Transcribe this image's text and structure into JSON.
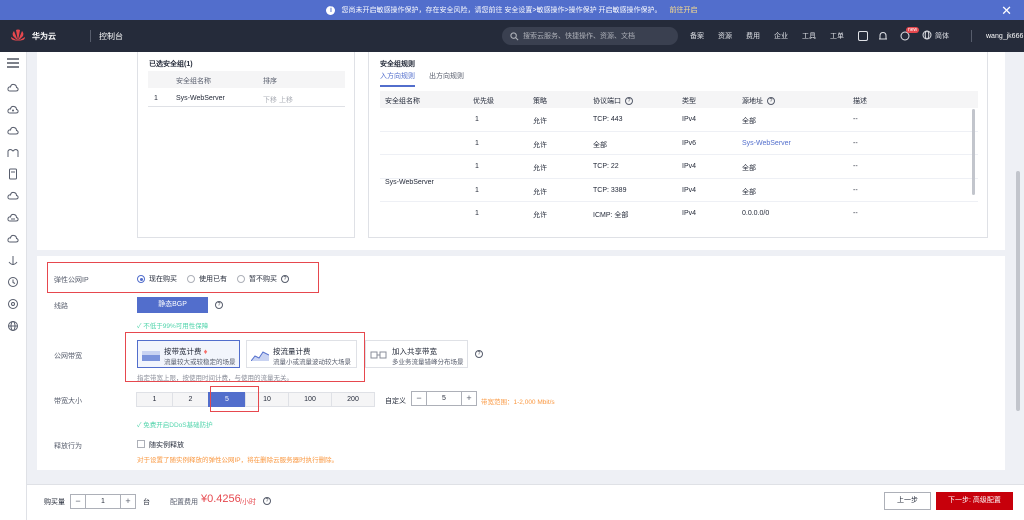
{
  "banner": {
    "text": "您尚未开启敏感操作保护，存在安全风险，请您前往 安全设置>敏感操作>操作保护 开启敏感操作保护。",
    "link": "前往开启"
  },
  "topnav": {
    "brand": "华为云",
    "console": "控制台",
    "search_placeholder": "搜索云服务、快捷操作、资源、文档",
    "items": [
      "备案",
      "资源",
      "费用",
      "企业",
      "工具",
      "工单"
    ],
    "badge": "new",
    "language": "简体",
    "user": "wang_jk666"
  },
  "selected_sg": {
    "title": "已选安全组(1)",
    "col_name": "安全组名称",
    "col_order": "排序",
    "rows": [
      {
        "index": "1",
        "name": "Sys-WebServer",
        "ops": "下移  上移"
      }
    ]
  },
  "rules": {
    "title": "安全组规则",
    "tabs": [
      "入方向规则",
      "出方向规则"
    ],
    "headers": [
      "安全组名称",
      "优先级",
      "策略",
      "协议端口",
      "类型",
      "源地址",
      "描述"
    ],
    "group_name": "Sys-WebServer",
    "rows": [
      {
        "priority": "1",
        "policy": "允许",
        "port": "TCP: 443",
        "type": "IPv4",
        "source": "全部",
        "desc": "--"
      },
      {
        "priority": "1",
        "policy": "允许",
        "port": "全部",
        "type": "IPv6",
        "source": "Sys-WebServer",
        "desc": "--"
      },
      {
        "priority": "1",
        "policy": "允许",
        "port": "TCP: 22",
        "type": "IPv4",
        "source": "全部",
        "desc": "--"
      },
      {
        "priority": "1",
        "policy": "允许",
        "port": "TCP: 3389",
        "type": "IPv4",
        "source": "全部",
        "desc": "--"
      },
      {
        "priority": "1",
        "policy": "允许",
        "port": "ICMP: 全部",
        "type": "IPv4",
        "source": "0.0.0.0/0",
        "desc": "--"
      }
    ]
  },
  "eip": {
    "label": "弹性公网IP",
    "options": [
      "现在购买",
      "使用已有",
      "暂不购买"
    ],
    "selected": "现在购买"
  },
  "line": {
    "label": "线路",
    "value": "静态BGP",
    "hint": "✓ 不低于99%可用性保障"
  },
  "billing": {
    "label": "公网带宽",
    "cards": [
      {
        "title": "按带宽计费",
        "desc": "流量较大或较稳定的场景"
      },
      {
        "title": "按流量计费",
        "desc": "流量小或流量波动较大场景"
      },
      {
        "title": "加入共享带宽",
        "desc": "多业务流量错峰分布场景"
      }
    ],
    "hint": "指定带宽上限，按使用时间计费，与使用的流量无关。"
  },
  "bandwidth": {
    "label": "带宽大小",
    "options": [
      "1",
      "2",
      "5",
      "10",
      "100",
      "200"
    ],
    "selected": "5",
    "custom_label": "自定义",
    "custom_value": "5",
    "range": "带宽范围：1-2,000 Mbit/s",
    "ddos": "✓ 免费开启DDoS基础防护"
  },
  "release": {
    "label": "释放行为",
    "checkbox": "随实例释放",
    "hint": "对于设置了随实例释放的弹性公网IP，将在删除云服务器时执行删除。"
  },
  "footer": {
    "qty_label": "购买量",
    "qty": "1",
    "unit": "台",
    "fee_label": "配置费用",
    "price": "¥0.4256",
    "price_unit": "/小时",
    "prev": "上一步",
    "next": "下一步: 高级配置"
  },
  "colors": {
    "accent": "#526ecc",
    "danger": "#e6484e",
    "primary_red": "#c7000b",
    "nav_bg": "#252b3a"
  }
}
